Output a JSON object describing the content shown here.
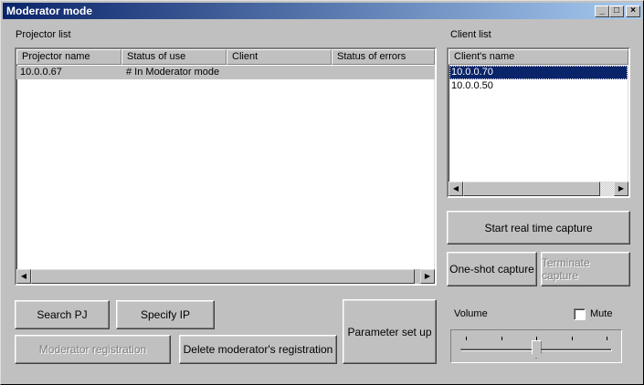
{
  "window": {
    "title": "Moderator mode",
    "controls": {
      "minimize": "_",
      "maximize": "□",
      "close": "×"
    }
  },
  "projector_list": {
    "label": "Projector list",
    "columns": [
      "Projector name",
      "Status of use",
      "Client",
      "Status of errors"
    ],
    "rows": [
      {
        "name": "10.0.0.67",
        "status": "# In Moderator mode",
        "client": "",
        "errors": ""
      }
    ]
  },
  "client_list": {
    "label": "Client list",
    "column": "Client's name",
    "rows": [
      "10.0.0.70",
      "10.0.0.50"
    ],
    "selected_index": 0
  },
  "buttons": {
    "search_pj": "Search PJ",
    "specify_ip": "Specify IP",
    "moderator_registration": "Moderator registration",
    "delete_registration": "Delete moderator's registration",
    "parameter_set_up": "Parameter set up",
    "start_capture": "Start real time capture",
    "one_shot_capture": "One-shot capture",
    "terminate_capture": "Terminate capture"
  },
  "volume": {
    "label": "Volume",
    "mute_label": "Mute",
    "mute_checked": false,
    "level_fraction": 0.5
  },
  "colors": {
    "selection": "#0a246a",
    "title_start": "#0a246a",
    "title_end": "#a6caf0"
  }
}
